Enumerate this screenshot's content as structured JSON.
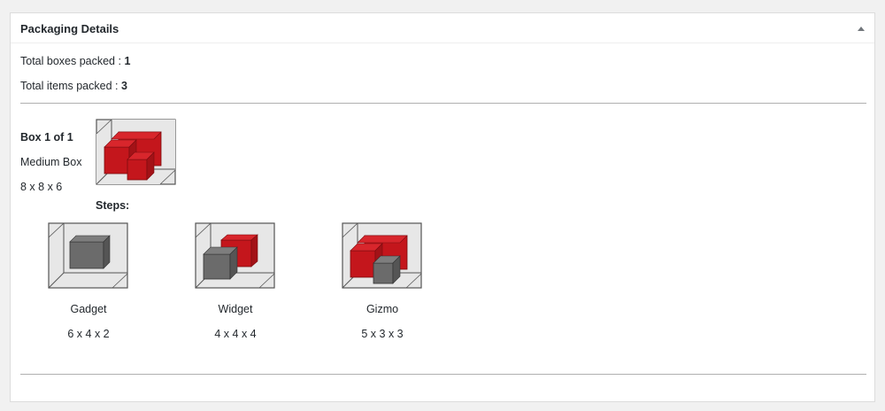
{
  "panel": {
    "title": "Packaging Details"
  },
  "summary": {
    "boxes_label": "Total boxes packed : ",
    "boxes_value": "1",
    "items_label": "Total items packed : ",
    "items_value": "3"
  },
  "box": {
    "heading": "Box 1 of 1",
    "name": "Medium Box",
    "dimensions": "8 x 8 x 6",
    "steps_label": "Steps:"
  },
  "steps": [
    {
      "name": "Gadget",
      "dimensions": "6 x 4 x 2"
    },
    {
      "name": "Widget",
      "dimensions": "4 x 4 x 4"
    },
    {
      "name": "Gizmo",
      "dimensions": "5 x 3 x 3"
    }
  ],
  "colors": {
    "packed_item": "#c4161c",
    "current_item": "#6b6b6b",
    "box_outline": "#555555"
  }
}
